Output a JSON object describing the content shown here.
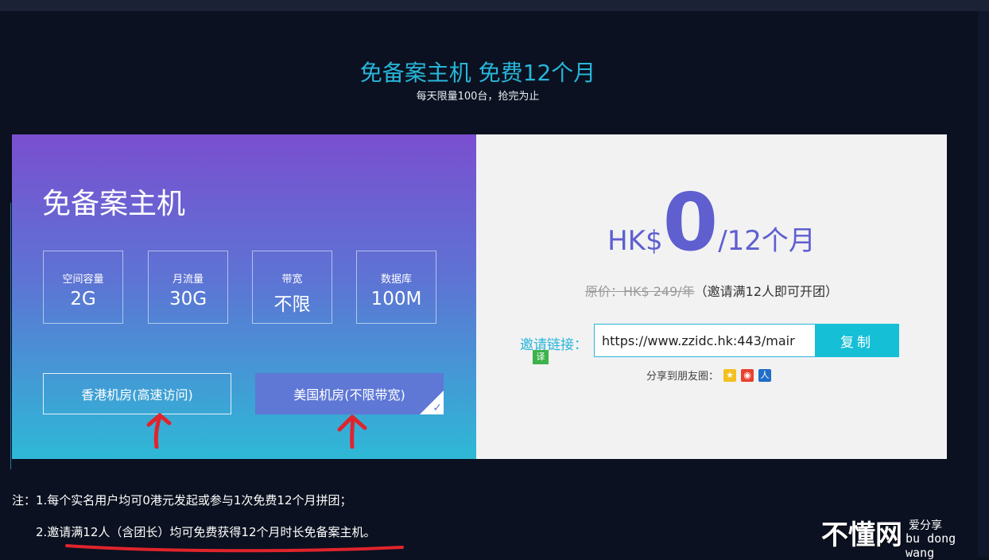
{
  "header": {
    "title": "免备案主机 免费12个月",
    "subtitle": "每天限量100台，抢完为止"
  },
  "plan": {
    "title": "免备案主机",
    "specs": [
      {
        "label": "空间容量",
        "value": "2G"
      },
      {
        "label": "月流量",
        "value": "30G"
      },
      {
        "label": "带宽",
        "value": "不限"
      },
      {
        "label": "数据库",
        "value": "100M"
      }
    ],
    "rooms": [
      {
        "label": "香港机房(高速访问)",
        "selected": false
      },
      {
        "label": "美国机房(不限带宽)",
        "selected": true
      }
    ]
  },
  "pricing": {
    "currency": "HK$",
    "amount": "0",
    "period": "/12个月",
    "original_price": "原价：HK$ 249/年",
    "original_note": "（邀请满12人即可开团）"
  },
  "invite": {
    "label": "邀请链接：",
    "translate_badge": "译",
    "link_value": "https://www.zzidc.hk:443/mair",
    "copy_label": "复制"
  },
  "share": {
    "label": "分享到朋友圈：",
    "icons": [
      "qzone-icon",
      "weibo-icon",
      "renren-icon"
    ]
  },
  "notes": {
    "line1": "注：1.每个实名用户均可0港元发起或参与1次免费12个月拼团；",
    "line2": "2.邀请满12人（含团长）均可免费获得12个月时长免备案主机。"
  },
  "watermark": {
    "main": "不懂网",
    "sub1": "爱分享",
    "sub2": "bu dong wang"
  },
  "colors": {
    "accent": "#27b6da",
    "price": "#5f5fd0",
    "annotation": "#e0242c"
  }
}
